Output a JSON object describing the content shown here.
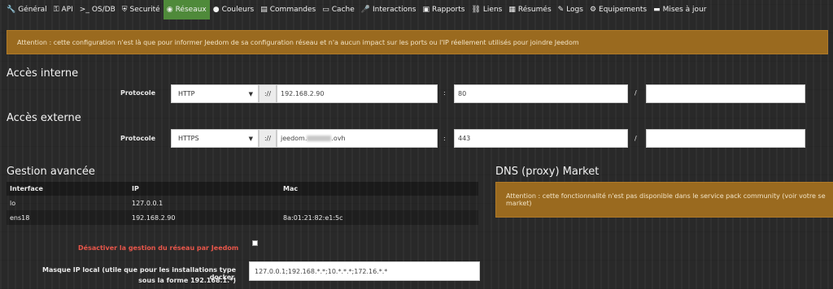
{
  "tabs": [
    {
      "icon": "wrench-icon",
      "glyph": "🔧",
      "label": "Général"
    },
    {
      "icon": "key-icon",
      "glyph": "⚿",
      "label": "API"
    },
    {
      "icon": "terminal-icon",
      "glyph": ">_",
      "label": "OS/DB"
    },
    {
      "icon": "shield-icon",
      "glyph": "⛨",
      "label": "Securité"
    },
    {
      "icon": "rss-icon",
      "glyph": "◉",
      "label": "Réseaux"
    },
    {
      "icon": "drop-icon",
      "glyph": "●",
      "label": "Couleurs"
    },
    {
      "icon": "calendar-icon",
      "glyph": "▤",
      "label": "Commandes"
    },
    {
      "icon": "hdd-icon",
      "glyph": "▭",
      "label": "Cache"
    },
    {
      "icon": "microphone-icon",
      "glyph": "🎤",
      "label": "Interactions"
    },
    {
      "icon": "report-icon",
      "glyph": "▣",
      "label": "Rapports"
    },
    {
      "icon": "link-icon",
      "glyph": "⛓",
      "label": "Liens"
    },
    {
      "icon": "table-icon",
      "glyph": "▦",
      "label": "Résumés"
    },
    {
      "icon": "edit-icon",
      "glyph": "✎",
      "label": "Logs"
    },
    {
      "icon": "cog-icon",
      "glyph": "⚙",
      "label": "Equipements"
    },
    {
      "icon": "credit-card-icon",
      "glyph": "▬",
      "label": "Mises à jour"
    }
  ],
  "active_tab": "Réseaux",
  "alert_top": "Attention : cette configuration n'est là que pour informer Jeedom de sa configuration réseau et n'a aucun impact sur les ports ou l'IP réellement utilisés pour joindre Jeedom",
  "internal": {
    "title": "Accès interne",
    "protocol_label": "Protocole",
    "protocol": "HTTP",
    "sep_scheme": "://",
    "address": "192.168.2.90",
    "sep_port": ":",
    "port": "80",
    "sep_path": "/",
    "path": ""
  },
  "external": {
    "title": "Accès externe",
    "protocol_label": "Protocole",
    "protocol": "HTTPS",
    "sep_scheme": "://",
    "address_prefix": "jeedom.",
    "address_suffix": ".ovh",
    "sep_port": ":",
    "port": "443",
    "sep_path": "/",
    "path": ""
  },
  "advanced": {
    "title": "Gestion avancée",
    "columns": [
      "Interface",
      "IP",
      "Mac"
    ],
    "rows": [
      [
        "lo",
        "127.0.0.1",
        ""
      ],
      [
        "ens18",
        "192.168.2.90",
        "8a:01:21:82:e1:5c"
      ]
    ],
    "disable_label": "Désactiver la gestion du réseau par Jeedom",
    "mask_label_1": "Masque IP local (utile que pour les installations type docker,",
    "mask_label_2": "sous la forme 192.168.1.*)",
    "mask_value": "127.0.0.1;192.168.*.*;10.*.*.*;172.16.*.*"
  },
  "dns": {
    "title": "DNS (proxy) Market",
    "alert_line1": "Attention : cette fonctionnalité n'est pas disponible dans le service pack community (voir votre se",
    "alert_line2": "market)"
  },
  "colors": {
    "accent": "#4f8a3a",
    "alert": "#9a6a1f",
    "danger": "#e8564a"
  }
}
